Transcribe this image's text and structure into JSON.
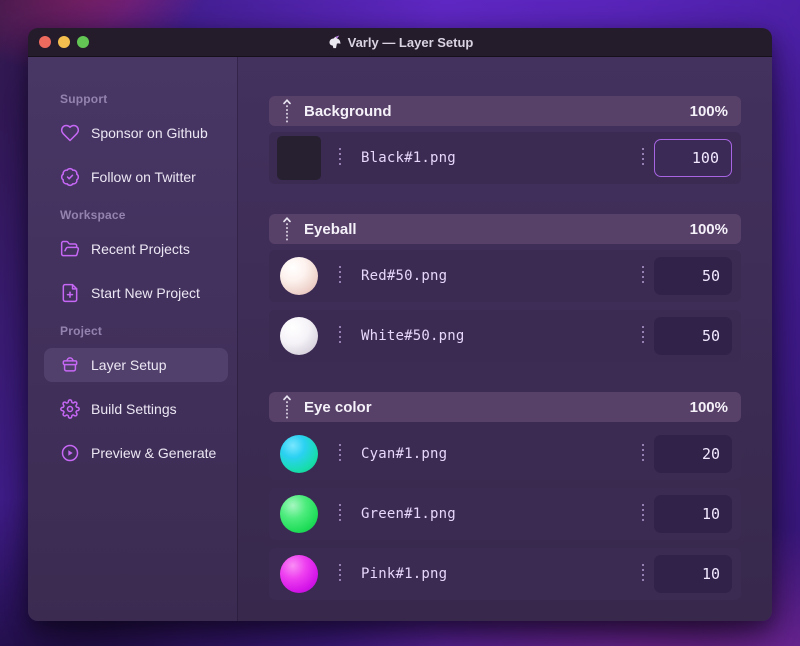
{
  "window": {
    "title": "Varly — Layer Setup",
    "app_icon": "unicorn-icon",
    "traffic_lights": [
      "close",
      "minimize",
      "zoom"
    ]
  },
  "sidebar": {
    "sections": [
      {
        "label": "Support",
        "items": [
          {
            "icon": "heart-icon",
            "label": "Sponsor on Github"
          },
          {
            "icon": "badge-check-icon",
            "label": "Follow on Twitter"
          }
        ]
      },
      {
        "label": "Workspace",
        "items": [
          {
            "icon": "folder-open-icon",
            "label": "Recent Projects"
          },
          {
            "icon": "file-plus-icon",
            "label": "Start New Project"
          }
        ]
      },
      {
        "label": "Project",
        "items": [
          {
            "icon": "archive-box-icon",
            "label": "Layer Setup",
            "selected": true
          },
          {
            "icon": "gear-icon",
            "label": "Build Settings"
          },
          {
            "icon": "play-circle-icon",
            "label": "Preview & Generate"
          }
        ]
      }
    ]
  },
  "layers_panel": {
    "groups": [
      {
        "name": "Background",
        "weight": "100%",
        "layers": [
          {
            "file": "Black#1.png",
            "value": "100",
            "thumb": "black-square",
            "focused": true
          }
        ]
      },
      {
        "name": "Eyeball",
        "weight": "100%",
        "layers": [
          {
            "file": "Red#50.png",
            "value": "50",
            "thumb": "red-sphere",
            "focused": false
          },
          {
            "file": "White#50.png",
            "value": "50",
            "thumb": "white-sphere",
            "focused": false
          }
        ]
      },
      {
        "name": "Eye color",
        "weight": "100%",
        "layers": [
          {
            "file": "Cyan#1.png",
            "value": "20",
            "thumb": "cyan-sphere",
            "focused": false
          },
          {
            "file": "Green#1.png",
            "value": "10",
            "thumb": "green-sphere",
            "focused": false
          },
          {
            "file": "Pink#1.png",
            "value": "10",
            "thumb": "pink-sphere",
            "focused": false
          }
        ]
      }
    ]
  },
  "colors": {
    "accent": "#a855f7",
    "focus_border": "#a765e3",
    "traffic_red": "#ed6a5f",
    "traffic_yellow": "#f5bf4f",
    "traffic_green": "#62c554"
  }
}
